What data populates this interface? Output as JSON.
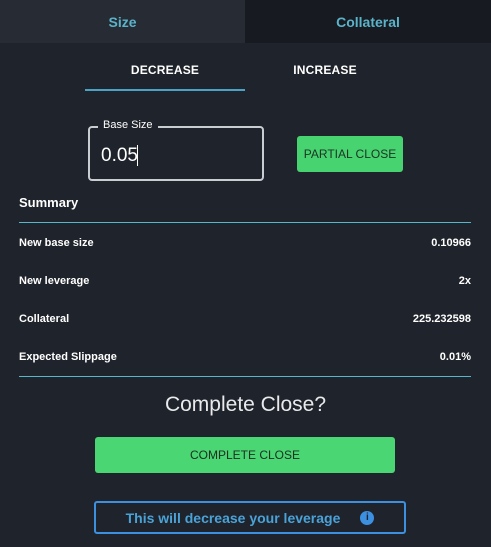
{
  "top_tabs": [
    {
      "label": "Size",
      "active": true
    },
    {
      "label": "Collateral",
      "active": false
    }
  ],
  "sub_tabs": [
    {
      "label": "DECREASE",
      "active": true
    },
    {
      "label": "INCREASE",
      "active": false
    }
  ],
  "base_size": {
    "label": "Base Size",
    "value": "0.05"
  },
  "partial_close_label": "PARTIAL CLOSE",
  "summary": {
    "title": "Summary",
    "rows": [
      {
        "label": "New base size",
        "value": "0.10966"
      },
      {
        "label": "New leverage",
        "value": "2x"
      },
      {
        "label": "Collateral",
        "value": "225.232598"
      },
      {
        "label": "Expected Slippage",
        "value": "0.01%"
      }
    ]
  },
  "complete_close": {
    "title": "Complete Close?",
    "button_label": "COMPLETE CLOSE"
  },
  "info": {
    "text": "This will decrease your leverage",
    "icon": "info-icon"
  },
  "colors": {
    "accent": "#5bb3c9",
    "green": "#47d36f",
    "info_blue": "#3d8fe0",
    "background": "#1f232b"
  }
}
